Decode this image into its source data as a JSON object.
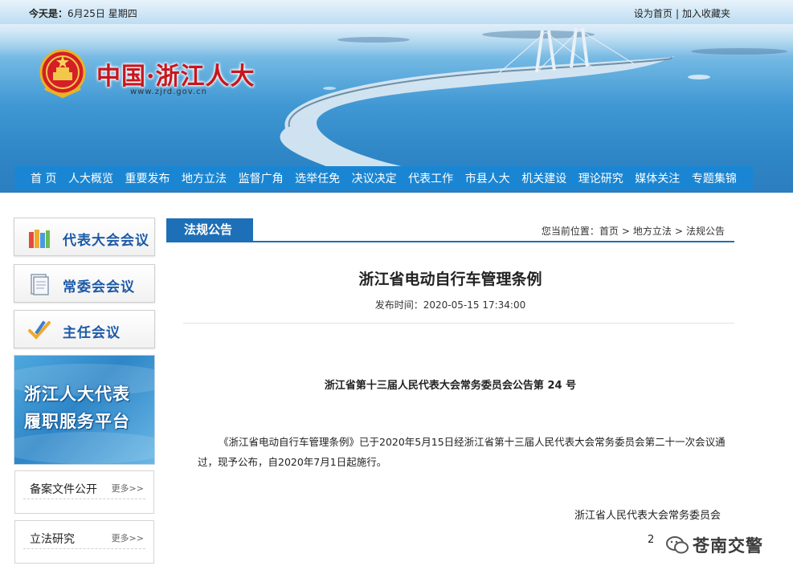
{
  "topbar": {
    "date_label": "今天是：",
    "date_value": "6月25日 星期四",
    "set_home": "设为首页",
    "separator": "|",
    "add_favorite": "加入收藏夹"
  },
  "site": {
    "title": "中国·浙江人大",
    "url": "www.zjrd.gov.cn"
  },
  "nav": {
    "items": [
      "首 页",
      "人大概览",
      "重要发布",
      "地方立法",
      "监督广角",
      "选举任免",
      "决议决定",
      "代表工作",
      "市县人大",
      "机关建设",
      "理论研究",
      "媒体关注",
      "专题集锦"
    ]
  },
  "sidebar": {
    "buttons": [
      {
        "label": "代表大会会议",
        "icon": "books-icon"
      },
      {
        "label": "常委会会议",
        "icon": "document-icon"
      },
      {
        "label": "主任会议",
        "icon": "pen-check-icon"
      }
    ],
    "promo": {
      "line1": "浙江人大代表",
      "line2": "履职服务平台"
    },
    "boxes": [
      {
        "title": "备案文件公开",
        "more": "更多>>"
      },
      {
        "title": "立法研究",
        "more": "更多>>"
      }
    ]
  },
  "section": {
    "tab_label": "法规公告",
    "breadcrumb_prefix": "您当前位置：",
    "breadcrumb": [
      "首页",
      "地方立法",
      "法规公告"
    ],
    "breadcrumb_sep": ">"
  },
  "article": {
    "title": "浙江省电动自行车管理条例",
    "publish_time": "发布时间：2020-05-15 17:34:00",
    "announcement_no": "浙江省第十三届人民代表大会常务委员会公告第 24 号",
    "body": "《浙江省电动自行车管理条例》已于2020年5月15日经浙江省第十三届人民代表大会常务委员会第二十一次会议通过，现予公布，自2020年7月1日起施行。",
    "signature": "浙江省人民代表大会常务委员会",
    "sign_date": "2"
  },
  "watermark": {
    "text": "苍南交警"
  },
  "colors": {
    "nav_bg": "#1a86d3",
    "section_blue": "#1d6fb8",
    "title_red": "#c8161d",
    "sidebar_label_blue": "#1d5aa8"
  }
}
